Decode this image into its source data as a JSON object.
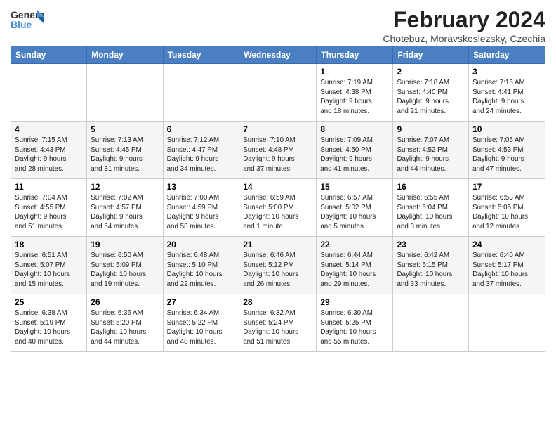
{
  "logo": {
    "text_general": "General",
    "text_blue": "Blue"
  },
  "header": {
    "title": "February 2024",
    "subtitle": "Chotebuz, Moravskoslezsky, Czechia"
  },
  "weekdays": [
    "Sunday",
    "Monday",
    "Tuesday",
    "Wednesday",
    "Thursday",
    "Friday",
    "Saturday"
  ],
  "weeks": [
    [
      {
        "day": "",
        "info": ""
      },
      {
        "day": "",
        "info": ""
      },
      {
        "day": "",
        "info": ""
      },
      {
        "day": "",
        "info": ""
      },
      {
        "day": "1",
        "info": "Sunrise: 7:19 AM\nSunset: 4:38 PM\nDaylight: 9 hours\nand 18 minutes."
      },
      {
        "day": "2",
        "info": "Sunrise: 7:18 AM\nSunset: 4:40 PM\nDaylight: 9 hours\nand 21 minutes."
      },
      {
        "day": "3",
        "info": "Sunrise: 7:16 AM\nSunset: 4:41 PM\nDaylight: 9 hours\nand 24 minutes."
      }
    ],
    [
      {
        "day": "4",
        "info": "Sunrise: 7:15 AM\nSunset: 4:43 PM\nDaylight: 9 hours\nand 28 minutes."
      },
      {
        "day": "5",
        "info": "Sunrise: 7:13 AM\nSunset: 4:45 PM\nDaylight: 9 hours\nand 31 minutes."
      },
      {
        "day": "6",
        "info": "Sunrise: 7:12 AM\nSunset: 4:47 PM\nDaylight: 9 hours\nand 34 minutes."
      },
      {
        "day": "7",
        "info": "Sunrise: 7:10 AM\nSunset: 4:48 PM\nDaylight: 9 hours\nand 37 minutes."
      },
      {
        "day": "8",
        "info": "Sunrise: 7:09 AM\nSunset: 4:50 PM\nDaylight: 9 hours\nand 41 minutes."
      },
      {
        "day": "9",
        "info": "Sunrise: 7:07 AM\nSunset: 4:52 PM\nDaylight: 9 hours\nand 44 minutes."
      },
      {
        "day": "10",
        "info": "Sunrise: 7:05 AM\nSunset: 4:53 PM\nDaylight: 9 hours\nand 47 minutes."
      }
    ],
    [
      {
        "day": "11",
        "info": "Sunrise: 7:04 AM\nSunset: 4:55 PM\nDaylight: 9 hours\nand 51 minutes."
      },
      {
        "day": "12",
        "info": "Sunrise: 7:02 AM\nSunset: 4:57 PM\nDaylight: 9 hours\nand 54 minutes."
      },
      {
        "day": "13",
        "info": "Sunrise: 7:00 AM\nSunset: 4:59 PM\nDaylight: 9 hours\nand 58 minutes."
      },
      {
        "day": "14",
        "info": "Sunrise: 6:59 AM\nSunset: 5:00 PM\nDaylight: 10 hours\nand 1 minute."
      },
      {
        "day": "15",
        "info": "Sunrise: 6:57 AM\nSunset: 5:02 PM\nDaylight: 10 hours\nand 5 minutes."
      },
      {
        "day": "16",
        "info": "Sunrise: 6:55 AM\nSunset: 5:04 PM\nDaylight: 10 hours\nand 8 minutes."
      },
      {
        "day": "17",
        "info": "Sunrise: 6:53 AM\nSunset: 5:05 PM\nDaylight: 10 hours\nand 12 minutes."
      }
    ],
    [
      {
        "day": "18",
        "info": "Sunrise: 6:51 AM\nSunset: 5:07 PM\nDaylight: 10 hours\nand 15 minutes."
      },
      {
        "day": "19",
        "info": "Sunrise: 6:50 AM\nSunset: 5:09 PM\nDaylight: 10 hours\nand 19 minutes."
      },
      {
        "day": "20",
        "info": "Sunrise: 6:48 AM\nSunset: 5:10 PM\nDaylight: 10 hours\nand 22 minutes."
      },
      {
        "day": "21",
        "info": "Sunrise: 6:46 AM\nSunset: 5:12 PM\nDaylight: 10 hours\nand 26 minutes."
      },
      {
        "day": "22",
        "info": "Sunrise: 6:44 AM\nSunset: 5:14 PM\nDaylight: 10 hours\nand 29 minutes."
      },
      {
        "day": "23",
        "info": "Sunrise: 6:42 AM\nSunset: 5:15 PM\nDaylight: 10 hours\nand 33 minutes."
      },
      {
        "day": "24",
        "info": "Sunrise: 6:40 AM\nSunset: 5:17 PM\nDaylight: 10 hours\nand 37 minutes."
      }
    ],
    [
      {
        "day": "25",
        "info": "Sunrise: 6:38 AM\nSunset: 5:19 PM\nDaylight: 10 hours\nand 40 minutes."
      },
      {
        "day": "26",
        "info": "Sunrise: 6:36 AM\nSunset: 5:20 PM\nDaylight: 10 hours\nand 44 minutes."
      },
      {
        "day": "27",
        "info": "Sunrise: 6:34 AM\nSunset: 5:22 PM\nDaylight: 10 hours\nand 48 minutes."
      },
      {
        "day": "28",
        "info": "Sunrise: 6:32 AM\nSunset: 5:24 PM\nDaylight: 10 hours\nand 51 minutes."
      },
      {
        "day": "29",
        "info": "Sunrise: 6:30 AM\nSunset: 5:25 PM\nDaylight: 10 hours\nand 55 minutes."
      },
      {
        "day": "",
        "info": ""
      },
      {
        "day": "",
        "info": ""
      }
    ]
  ]
}
